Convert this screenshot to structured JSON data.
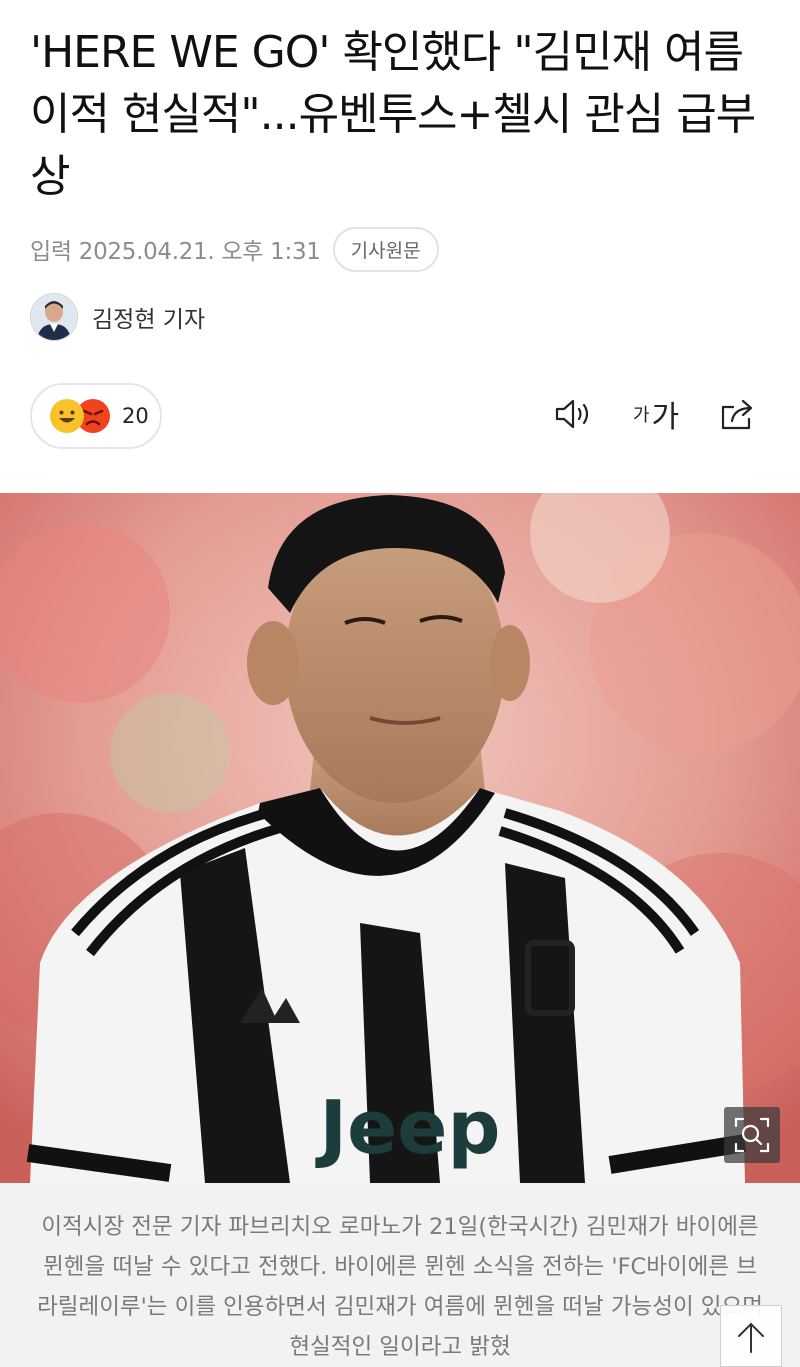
{
  "article": {
    "title": "'HERE WE GO' 확인했다 \"김민재 여름 이적 현실적\"...유벤투스+첼시 관심 급부상",
    "date_label": "입력 2025.04.21. 오후 1:31",
    "original_link_label": "기사원문",
    "reporter_name": "김정현 기자"
  },
  "reactions": {
    "icons": [
      "smile-emoji",
      "angry-emoji"
    ],
    "count": "20"
  },
  "toolbar": {
    "audio_icon": "speaker-icon",
    "font_size_label_small": "가",
    "font_size_label_large": "가",
    "share_icon": "share-icon"
  },
  "photo": {
    "description_icon": "zoom-icon",
    "jersey_sponsor": "Jeep"
  },
  "caption": {
    "text": "이적시장 전문 기자 파브리치오 로마노가 21일(한국시간) 김민재가 바이에른 뮌헨을 떠날 수 있다고 전했다.  바이에른 뮌헨 소식을 전하는 'FC바이에른 브라릴레이루'는 이를 인용하면서 김민재가 여름에 뮌헨을 떠날 가능성이 있으며 현실적인 일이라고 밝혔"
  },
  "colors": {
    "accent_text": "#111111",
    "meta_gray": "#8c8c8c",
    "caption_bg": "#f2f2f2"
  }
}
